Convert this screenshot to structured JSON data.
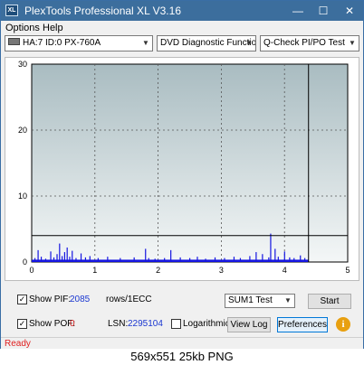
{
  "window": {
    "title": "PlexTools Professional XL V3.16",
    "app_icon_text": "XL",
    "minimize_glyph": "—",
    "maximize_glyph": "☐",
    "close_glyph": "✕"
  },
  "menu": {
    "options": "Options",
    "help": "Help"
  },
  "toolbar": {
    "drive": "HA:7 ID:0  PX-760A",
    "function": "DVD Diagnostic Functions",
    "test": "Q-Check PI/PO Test"
  },
  "chart_data": {
    "type": "bar",
    "x_ticks": [
      "0",
      "1",
      "2",
      "3",
      "4",
      "5"
    ],
    "y_ticks": [
      "0",
      "10",
      "20",
      "30"
    ],
    "xlim": [
      0,
      5
    ],
    "ylim": [
      0,
      30
    ],
    "grid": true,
    "threshold": 4,
    "end_marker": 4.38,
    "pif_spikes": [
      {
        "x": 0.05,
        "y": 0.6
      },
      {
        "x": 0.1,
        "y": 1.8
      },
      {
        "x": 0.15,
        "y": 0.8
      },
      {
        "x": 0.22,
        "y": 0.5
      },
      {
        "x": 0.3,
        "y": 1.6
      },
      {
        "x": 0.35,
        "y": 0.7
      },
      {
        "x": 0.4,
        "y": 1.2
      },
      {
        "x": 0.44,
        "y": 2.8
      },
      {
        "x": 0.48,
        "y": 0.9
      },
      {
        "x": 0.52,
        "y": 1.5
      },
      {
        "x": 0.56,
        "y": 2.2
      },
      {
        "x": 0.6,
        "y": 0.8
      },
      {
        "x": 0.64,
        "y": 1.7
      },
      {
        "x": 0.7,
        "y": 0.6
      },
      {
        "x": 0.78,
        "y": 1.3
      },
      {
        "x": 0.85,
        "y": 0.7
      },
      {
        "x": 0.92,
        "y": 0.9
      },
      {
        "x": 1.05,
        "y": 0.6
      },
      {
        "x": 1.2,
        "y": 0.8
      },
      {
        "x": 1.4,
        "y": 0.6
      },
      {
        "x": 1.62,
        "y": 0.7
      },
      {
        "x": 1.8,
        "y": 2.0
      },
      {
        "x": 1.85,
        "y": 0.6
      },
      {
        "x": 1.95,
        "y": 0.5
      },
      {
        "x": 2.1,
        "y": 0.6
      },
      {
        "x": 2.2,
        "y": 1.8
      },
      {
        "x": 2.35,
        "y": 0.7
      },
      {
        "x": 2.5,
        "y": 0.6
      },
      {
        "x": 2.62,
        "y": 0.8
      },
      {
        "x": 2.75,
        "y": 0.5
      },
      {
        "x": 2.9,
        "y": 0.7
      },
      {
        "x": 3.05,
        "y": 0.6
      },
      {
        "x": 3.2,
        "y": 0.8
      },
      {
        "x": 3.3,
        "y": 0.6
      },
      {
        "x": 3.45,
        "y": 0.9
      },
      {
        "x": 3.55,
        "y": 1.5
      },
      {
        "x": 3.65,
        "y": 1.2
      },
      {
        "x": 3.75,
        "y": 0.7
      },
      {
        "x": 3.78,
        "y": 4.3
      },
      {
        "x": 3.85,
        "y": 2.0
      },
      {
        "x": 3.9,
        "y": 0.8
      },
      {
        "x": 4.0,
        "y": 1.6
      },
      {
        "x": 4.08,
        "y": 0.7
      },
      {
        "x": 4.15,
        "y": 0.6
      },
      {
        "x": 4.25,
        "y": 1.0
      },
      {
        "x": 4.32,
        "y": 0.6
      }
    ],
    "baseline_level": 0.35
  },
  "controls": {
    "show_pif_label": "Show PIF:",
    "pif_value": "2085",
    "rows_label": "rows/1ECC",
    "show_pof_label": "Show POF:",
    "pof_value": "0",
    "lsn_label": "LSN:",
    "lsn_value": "2295104",
    "logarithmic_label": "Logarithmic",
    "sum_select": "SUM1 Test",
    "start_button": "Start",
    "view_log_button": "View Log",
    "preferences_button": "Preferences",
    "info_glyph": "i",
    "check_glyph": "✓"
  },
  "status": {
    "text": "Ready"
  },
  "caption": {
    "text": "569x551  25kb  PNG"
  }
}
